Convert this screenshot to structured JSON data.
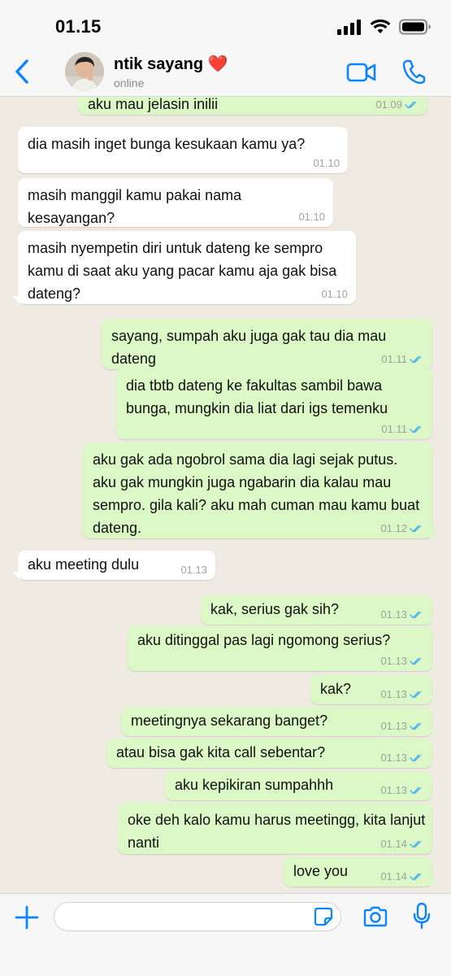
{
  "status_bar": {
    "time": "01.15"
  },
  "header": {
    "contact_name": "ntik sayang ❤️",
    "status": "online",
    "icons": [
      "back-chevron-icon",
      "video-camera-icon",
      "phone-icon"
    ]
  },
  "messages": [
    {
      "dir": "out",
      "text": "aku mau jelasin inilii",
      "time": "01.09",
      "read": true
    },
    {
      "dir": "in",
      "text": "dia masih inget bunga kesukaan kamu ya?",
      "time": "01.10"
    },
    {
      "dir": "in",
      "text": "masih manggil kamu pakai nama kesayangan?",
      "time": "01.10"
    },
    {
      "dir": "in",
      "text": "masih nyempetin diri untuk dateng ke sempro kamu di saat aku yang pacar kamu aja gak bisa dateng?",
      "time": "01.10"
    },
    {
      "dir": "out",
      "text": "sayang, sumpah aku juga gak tau dia mau dateng",
      "time": "01.11",
      "read": true
    },
    {
      "dir": "out",
      "text": "dia tbtb dateng ke fakultas sambil bawa bunga, mungkin dia liat dari igs temenku",
      "time": "01.11",
      "read": true
    },
    {
      "dir": "out",
      "text": "aku gak ada ngobrol sama dia lagi sejak putus. aku gak mungkin juga ngabarin dia kalau mau sempro. gila kali? aku mah cuman mau kamu buat dateng.",
      "time": "01.12",
      "read": true
    },
    {
      "dir": "in",
      "text": "aku meeting dulu",
      "time": "01.13"
    },
    {
      "dir": "out",
      "text": "kak, serius gak sih?",
      "time": "01.13",
      "read": true
    },
    {
      "dir": "out",
      "text": "aku ditinggal pas lagi ngomong serius?",
      "time": "01.13",
      "read": true
    },
    {
      "dir": "out",
      "text": "kak?",
      "time": "01.13",
      "read": true
    },
    {
      "dir": "out",
      "text": "meetingnya sekarang banget?",
      "time": "01.13",
      "read": true
    },
    {
      "dir": "out",
      "text": "atau bisa gak kita call sebentar?",
      "time": "01.13",
      "read": true
    },
    {
      "dir": "out",
      "text": "aku kepikiran sumpahhh",
      "time": "01.13",
      "read": true
    },
    {
      "dir": "out",
      "text": "oke deh kalo kamu harus meetingg, kita lanjut nanti",
      "time": "01.14",
      "read": true
    },
    {
      "dir": "out",
      "text": "love you",
      "time": "01.14",
      "read": true
    }
  ],
  "input_bar": {
    "placeholder": "",
    "icons": [
      "plus-icon",
      "sticker-icon",
      "camera-icon",
      "microphone-icon"
    ]
  },
  "colors": {
    "accent": "#0a84ff",
    "outgoing_bubble": "#dcf8c6",
    "incoming_bubble": "#ffffff",
    "chat_background": "#efeae2",
    "read_ticks": "#4fb6ec"
  }
}
